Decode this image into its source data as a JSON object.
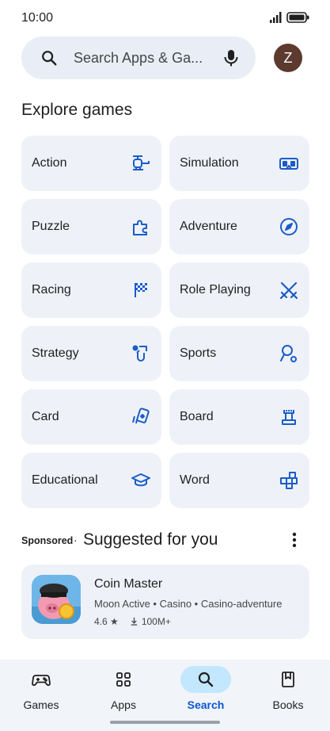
{
  "status_bar": {
    "time": "10:00",
    "signal_icon": "signal-icon",
    "battery_icon": "battery-icon"
  },
  "search": {
    "placeholder": "Search Apps & Ga...",
    "search_icon": "search-icon",
    "mic_icon": "mic-icon"
  },
  "account": {
    "avatar_letter": "Z",
    "avatar_color": "#5d3a2e"
  },
  "explore": {
    "title": "Explore games",
    "categories": [
      {
        "label": "Action",
        "icon": "helicopter-icon"
      },
      {
        "label": "Simulation",
        "icon": "vr-headset-icon"
      },
      {
        "label": "Puzzle",
        "icon": "puzzle-piece-icon"
      },
      {
        "label": "Adventure",
        "icon": "compass-icon"
      },
      {
        "label": "Racing",
        "icon": "checkered-flag-icon"
      },
      {
        "label": "Role Playing",
        "icon": "crossed-swords-icon"
      },
      {
        "label": "Strategy",
        "icon": "strategy-icon"
      },
      {
        "label": "Sports",
        "icon": "sports-icon"
      },
      {
        "label": "Card",
        "icon": "cards-icon"
      },
      {
        "label": "Board",
        "icon": "chess-rook-icon"
      },
      {
        "label": "Educational",
        "icon": "graduation-cap-icon"
      },
      {
        "label": "Word",
        "icon": "word-blocks-icon"
      }
    ]
  },
  "suggested": {
    "sponsored_label": "Sponsored",
    "separator": "·",
    "title": "Suggested for you",
    "more_icon": "more-vert-icon",
    "app": {
      "name": "Coin Master",
      "meta": "Moon Active • Casino • Casino-adventure",
      "rating": "4.6",
      "downloads": "100M+"
    }
  },
  "bottom_nav": {
    "items": [
      {
        "label": "Games",
        "icon": "gamepad-icon",
        "active": false
      },
      {
        "label": "Apps",
        "icon": "apps-grid-icon",
        "active": false
      },
      {
        "label": "Search",
        "icon": "search-icon",
        "active": true
      },
      {
        "label": "Books",
        "icon": "bookmark-book-icon",
        "active": false
      }
    ]
  },
  "colors": {
    "accent": "#0b57d0",
    "icon_blue": "#1a5cc8",
    "tile_bg": "#eef2f8",
    "search_bg": "#e9eef6",
    "active_pill": "#c2e7ff"
  }
}
